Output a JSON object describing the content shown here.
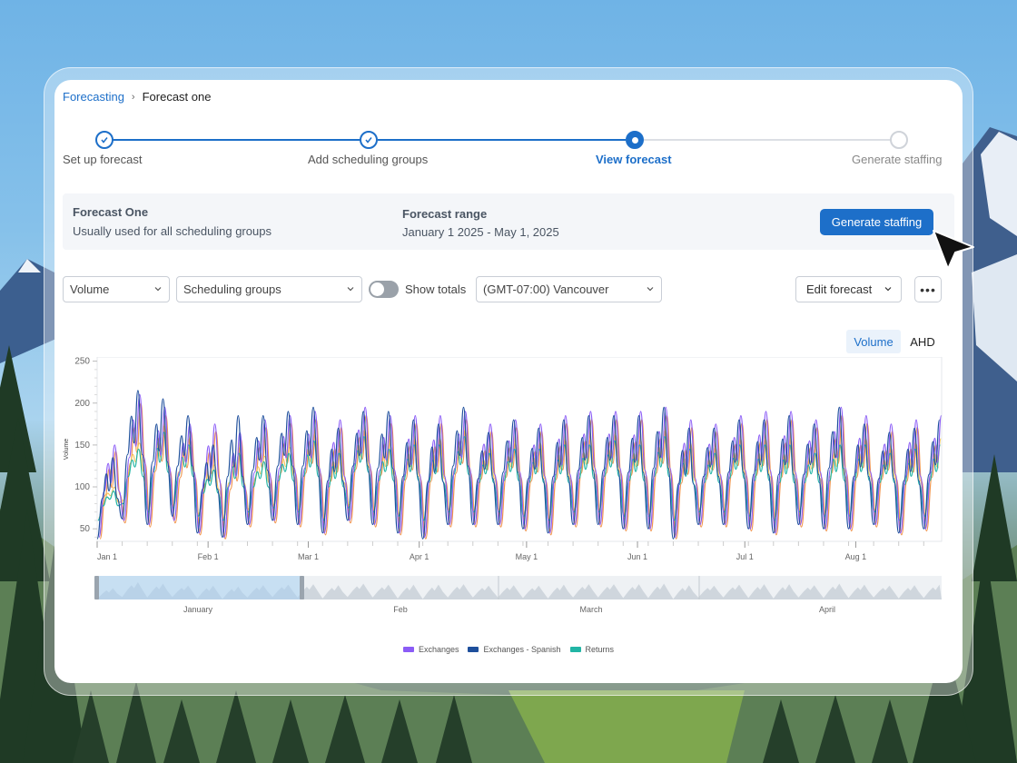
{
  "breadcrumb": {
    "root": "Forecasting",
    "current": "Forecast one"
  },
  "stepper": [
    {
      "label": "Set up forecast",
      "state": "done"
    },
    {
      "label": "Add scheduling groups",
      "state": "done"
    },
    {
      "label": "View forecast",
      "state": "active"
    },
    {
      "label": "Generate staffing",
      "state": "pending"
    }
  ],
  "info": {
    "name": "Forecast One",
    "description": "Usually used for all scheduling groups",
    "range_label": "Forecast range",
    "range": "January 1 2025 - May 1, 2025",
    "generate_label": "Generate staffing"
  },
  "controls": {
    "metric": "Volume",
    "groups": "Scheduling groups",
    "toggle_label": "Show totals",
    "timezone": "(GMT-07:00) Vancouver",
    "edit_label": "Edit forecast",
    "more_label": "•••"
  },
  "view_toggle": {
    "volume": "Volume",
    "ahd": "AHD"
  },
  "colors": {
    "accent": "#1d6fc9",
    "exchanges": "#8b5cf6",
    "exchanges_spanish": "#1e4f9c",
    "returns": "#22b5a5",
    "orange": "#f08a3c",
    "yellow": "#f5c04a"
  },
  "chart_data": {
    "type": "line",
    "ylabel": "Volume",
    "ylim": [
      35,
      255
    ],
    "yticks": [
      50,
      100,
      150,
      200,
      250
    ],
    "x_tick_labels": [
      "Jan 1",
      "Feb 1",
      "Mar 1",
      "Apr 1",
      "May 1",
      "Jun 1",
      "Jul 1",
      "Aug 1"
    ],
    "x_tick_days": [
      0,
      31,
      59,
      90,
      120,
      151,
      181,
      212
    ],
    "x_range_days": [
      0,
      236
    ],
    "weekly_peaks": {
      "Exchanges": [
        150,
        210,
        195,
        175,
        175,
        165,
        180,
        185,
        190,
        180,
        195,
        185,
        185,
        185,
        190,
        175,
        180,
        175,
        185,
        190,
        190,
        190,
        195,
        180,
        175,
        185,
        190,
        190,
        180,
        195,
        185,
        175,
        180,
        185
      ],
      "Exchanges - Spanish": [
        135,
        215,
        205,
        185,
        150,
        185,
        185,
        190,
        195,
        170,
        190,
        190,
        180,
        175,
        195,
        165,
        180,
        170,
        180,
        185,
        185,
        185,
        195,
        170,
        170,
        180,
        180,
        185,
        175,
        195,
        175,
        165,
        170,
        180
      ],
      "Returns": [
        95,
        145,
        165,
        150,
        120,
        140,
        130,
        140,
        155,
        140,
        160,
        145,
        150,
        150,
        160,
        140,
        145,
        145,
        150,
        150,
        155,
        150,
        160,
        145,
        140,
        150,
        150,
        150,
        140,
        150,
        150,
        140,
        145,
        150
      ]
    },
    "weekly_troughs": {
      "Exchanges": [
        40,
        60,
        55,
        60,
        45,
        40,
        55,
        60,
        55,
        45,
        60,
        55,
        45,
        40,
        55,
        55,
        55,
        50,
        45,
        55,
        55,
        50,
        50,
        40,
        55,
        55,
        50,
        45,
        55,
        50,
        50,
        55,
        45,
        50
      ],
      "Exchanges - Spanish": [
        38,
        62,
        55,
        65,
        45,
        40,
        55,
        60,
        55,
        45,
        60,
        55,
        45,
        38,
        55,
        55,
        55,
        50,
        45,
        55,
        55,
        50,
        50,
        38,
        55,
        55,
        50,
        45,
        55,
        50,
        50,
        55,
        45,
        50
      ],
      "Returns": [
        60,
        80,
        70,
        75,
        65,
        60,
        70,
        75,
        70,
        60,
        75,
        70,
        65,
        60,
        70,
        70,
        70,
        65,
        60,
        70,
        70,
        65,
        65,
        60,
        70,
        70,
        65,
        60,
        70,
        65,
        65,
        70,
        60,
        65
      ]
    },
    "series": [
      {
        "name": "Exchanges"
      },
      {
        "name": "Exchanges - Spanish"
      },
      {
        "name": "Returns"
      }
    ],
    "navigator_labels": [
      "January",
      "Feb",
      "March",
      "April"
    ],
    "legend_placement": "bottom-center",
    "grid": false
  }
}
